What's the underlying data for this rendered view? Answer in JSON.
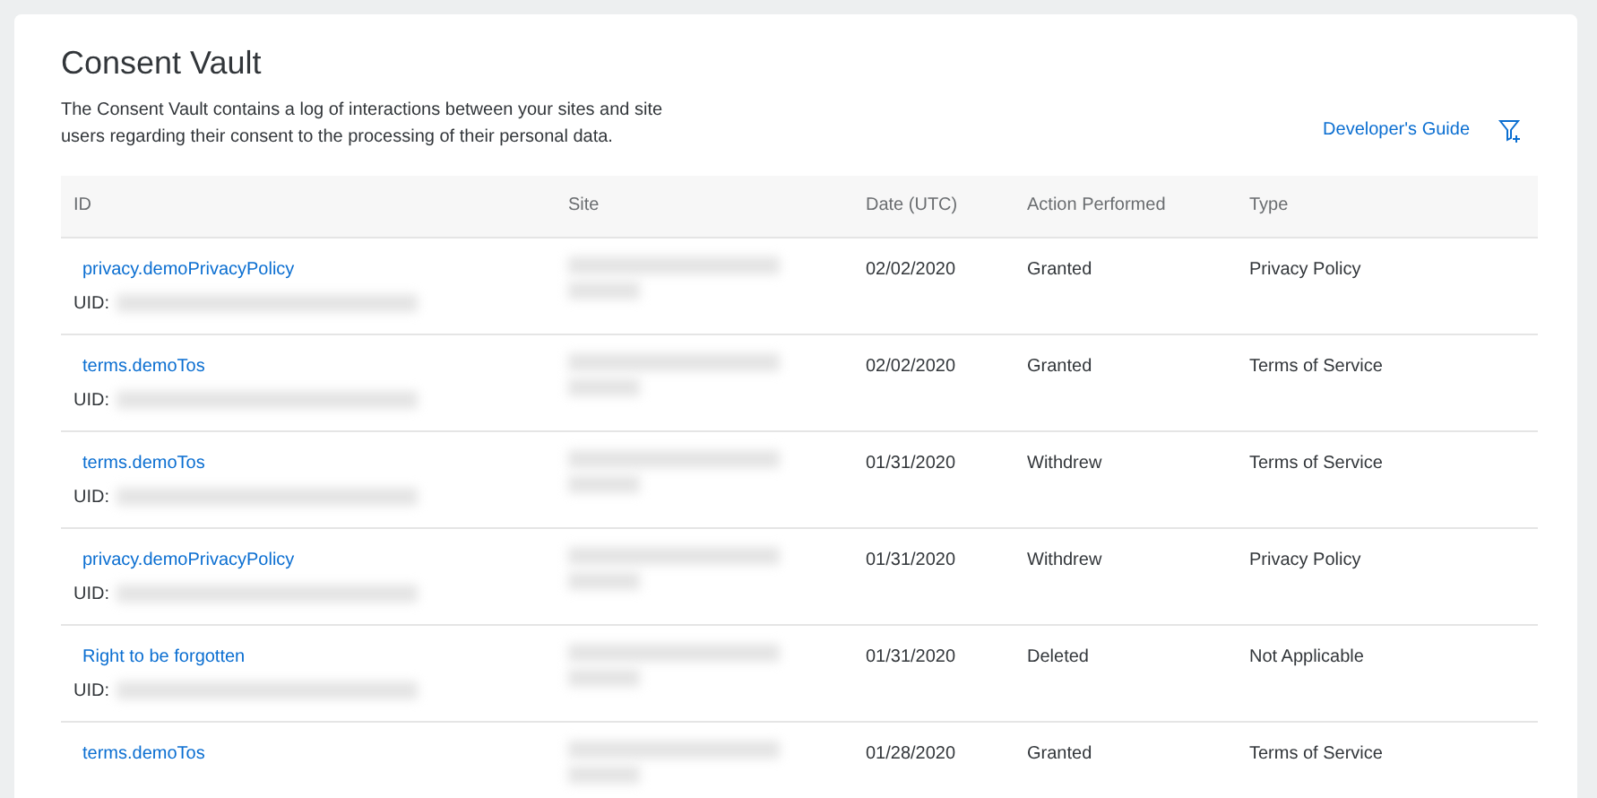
{
  "page": {
    "title": "Consent Vault",
    "description": "The Consent Vault contains a log of interactions between your sites and site users regarding their consent to the processing of their personal data.",
    "guide_link": "Developer's Guide"
  },
  "table": {
    "columns": [
      "ID",
      "Site",
      "Date (UTC)",
      "Action Performed",
      "Type"
    ],
    "rows": [
      {
        "id": "privacy.demoPrivacyPolicy",
        "uid_label": "UID:",
        "date": "02/02/2020",
        "action": "Granted",
        "type": "Privacy Policy"
      },
      {
        "id": "terms.demoTos",
        "uid_label": "UID:",
        "date": "02/02/2020",
        "action": "Granted",
        "type": "Terms of Service"
      },
      {
        "id": "terms.demoTos",
        "uid_label": "UID:",
        "date": "01/31/2020",
        "action": "Withdrew",
        "type": "Terms of Service"
      },
      {
        "id": "privacy.demoPrivacyPolicy",
        "uid_label": "UID:",
        "date": "01/31/2020",
        "action": "Withdrew",
        "type": "Privacy Policy"
      },
      {
        "id": "Right to be forgotten",
        "uid_label": "UID:",
        "date": "01/31/2020",
        "action": "Deleted",
        "type": "Not Applicable"
      },
      {
        "id": "terms.demoTos",
        "date": "01/28/2020",
        "action": "Granted",
        "type": "Terms of Service"
      }
    ]
  }
}
